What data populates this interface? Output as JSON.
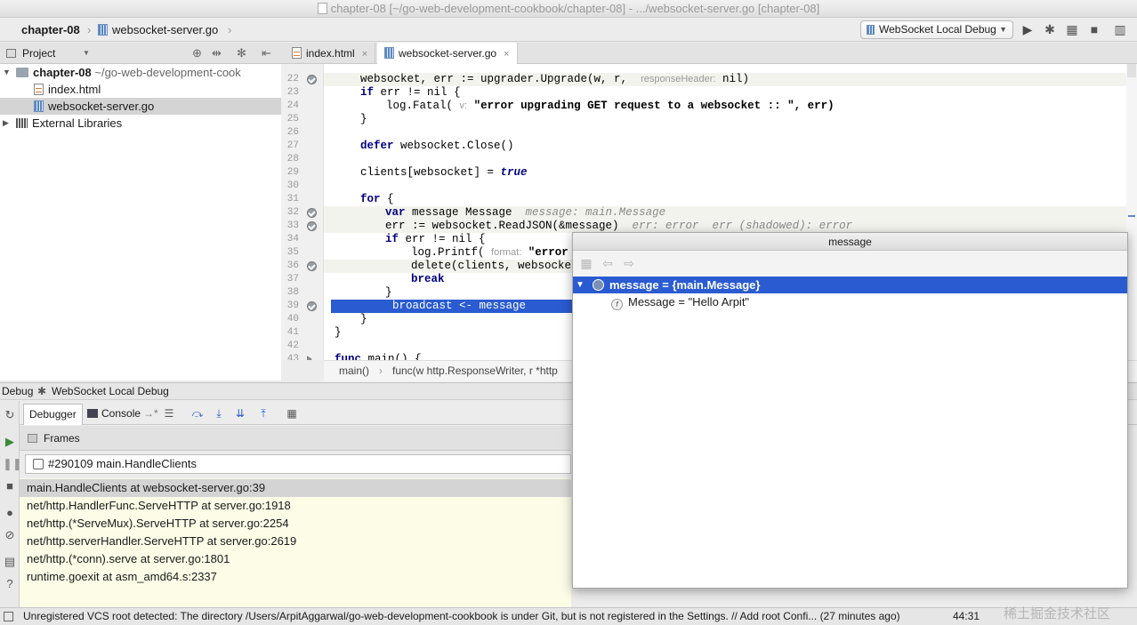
{
  "window": {
    "title": "chapter-08 [~/go-web-development-cookbook/chapter-08] - .../websocket-server.go [chapter-08]"
  },
  "nav": {
    "crumb_project": "chapter-08",
    "crumb_file": "websocket-server.go",
    "run_config": "WebSocket Local Debug"
  },
  "project": {
    "header": "Project",
    "tree": [
      {
        "label": "chapter-08",
        "suffix": "~/go-web-development-cook"
      },
      {
        "label": "index.html"
      },
      {
        "label": "websocket-server.go"
      },
      {
        "label": "External Libraries"
      }
    ]
  },
  "editor": {
    "tabs": [
      {
        "label": "index.html"
      },
      {
        "label": "websocket-server.go"
      }
    ],
    "line_numbers": [
      "22",
      "23",
      "24",
      "25",
      "26",
      "27",
      "28",
      "29",
      "30",
      "31",
      "32",
      "33",
      "34",
      "35",
      "36",
      "37",
      "38",
      "39",
      "40",
      "41",
      "42",
      "43"
    ],
    "code": {
      "l22a": "websocket, err := upgrader.Upgrade(w, r,  ",
      "l22hint": "responseHeader:",
      "l22b": " nil)",
      "l23kw": "if",
      "l23": " err != nil {",
      "l24a": "log.Fatal( ",
      "l24hint": "v:",
      "l24b": " \"error upgrading GET request to a websocket :: \", err)",
      "l25": "}",
      "l27kw": "defer",
      "l27": " websocket.Close()",
      "l29a": "clients[websocket] = ",
      "l29b": "true",
      "l31kw": "for",
      "l31": " {",
      "l32kw": "var",
      "l32": " message Message  ",
      "l32hint": "message: main.Message",
      "l33": "err := websocket.ReadJSON(&message)  ",
      "l33hint": "err: error  err (shadowed): error",
      "l34kw": "if",
      "l34": " err != nil {",
      "l35a": "log.Printf( ",
      "l35hint": "format:",
      "l35b": " \"error o",
      "l36": "delete(clients, websocket)",
      "l37": "break",
      "l38": "}",
      "l39": "broadcast <- message",
      "l40": "}",
      "l41": "}",
      "l43kw": "func",
      "l43": " main() {"
    },
    "breadcrumb": {
      "a": "main()",
      "b": "func(w http.ResponseWriter, r *http"
    }
  },
  "debug": {
    "title": "Debug",
    "config": "WebSocket Local Debug",
    "tab_debugger": "Debugger",
    "tab_console": "Console",
    "frames_header": "Frames",
    "thread": "#290109 main.HandleClients",
    "frames": [
      "main.HandleClients at websocket-server.go:39",
      "net/http.HandlerFunc.ServeHTTP at server.go:1918",
      "net/http.(*ServeMux).ServeHTTP at server.go:2254",
      "net/http.serverHandler.ServeHTTP at server.go:2619",
      "net/http.(*conn).serve at server.go:1801",
      "runtime.goexit at asm_amd64.s:2337"
    ]
  },
  "popup": {
    "title": "message",
    "rows": [
      {
        "text": "message = {main.Message}"
      },
      {
        "text": "Message = \"Hello Arpit\""
      }
    ]
  },
  "status": {
    "message": "Unregistered VCS root detected: The directory /Users/ArpitAggarwal/go-web-development-cookbook is under Git, but is not registered in the Settings. // Add root  Confi... (27 minutes ago)",
    "position": "44:31",
    "watermark": "稀土掘金技术社区"
  },
  "colors": {
    "selection": "#2a5bd0",
    "frames_bg": "#fcfce7",
    "keyword": "#000080"
  }
}
